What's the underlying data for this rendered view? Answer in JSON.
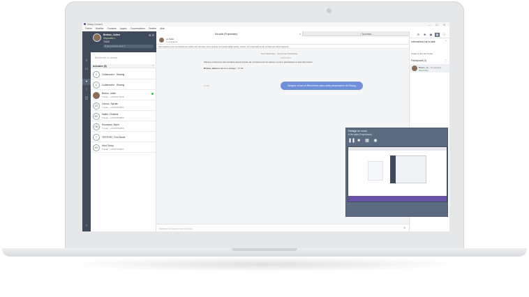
{
  "app": {
    "title": "Dialog Connect",
    "win_controls": [
      "—",
      "☐",
      "✕"
    ]
  },
  "menu": [
    "Fichier",
    "Modifier",
    "Contacts",
    "Appels",
    "Conversations",
    "Fenêtre",
    "Aide"
  ],
  "profile": {
    "name": "Breton, Julien",
    "status": "Disponible ▾",
    "extension": "75155",
    "note": "À quoi pensez-vous ?"
  },
  "contacts": {
    "search_placeholder": "Rechercher un contact",
    "directory_title": "Annuaire (8)",
    "items": [
      {
        "initials": "C",
        "name": "Collaborator - Sharing",
        "sub": "",
        "photo": false,
        "online": false
      },
      {
        "initials": "C",
        "name": "Collaborator - Sharing",
        "sub": "",
        "photo": false,
        "online": false
      },
      {
        "initials": "",
        "name": "Breton, Julien",
        "sub": "Travail : +33183774038",
        "photo": true,
        "online": true
      },
      {
        "initials": "CS",
        "name": "Caruso, Sylvain",
        "sub": "Travail : +33183784853",
        "photo": false,
        "online": false
      },
      {
        "initials": "MC",
        "name": "Mallet, Christine",
        "sub": "Travail : +33183784850",
        "photo": false,
        "online": false
      },
      {
        "initials": "RM",
        "name": "Rousseau, Marie",
        "sub": "Travail : +33183784856",
        "photo": false,
        "online": false
      },
      {
        "initials": "T",
        "name": "TESTDRC, First Name",
        "sub": "",
        "photo": false,
        "online": false
      },
      {
        "initials": "HG",
        "name": "Hunt Group",
        "sub": "Travail : +33183784851",
        "photo": false,
        "online": false
      }
    ]
  },
  "chat": {
    "tab_active": "Ma salle (Propriétaire)",
    "tab_other": "○ Nouveau...",
    "room_line1": "Le Salut",
    "room_line2": "1 participant",
    "info_bar": "Informations pour la conférence audio non fournies. Pour activer la fonctionnalité audio, entrez vos informations de conférence dans Options.",
    "links": "Tout l'historique  ·  Supprimer l'historique",
    "date": "12/01/2017",
    "system_msg": "Glissez et déposez des contacts depuis la liste de contacts pour les ajouter comme participants à cette discussion.",
    "share_msg_name": "Breton, Julien",
    "share_msg_rest": " a lancé le partage : 17:05",
    "bubble": "Bonjour à tous et Bienvenue dans cette présentation de Dialog",
    "time": "17:06",
    "composer_placeholder": "Saisissez un texte ici pour envoyer..."
  },
  "right_panel": {
    "info_title": "Informations sur la salle",
    "link_label": "Copier le lien de l'invité",
    "participants_title": "Participants (1)",
    "participant_name": "Breton, Ju...",
    "participant_role": "Propriétaire",
    "participant_status": "Disponible"
  },
  "share": {
    "title": "Partage en cours",
    "subtitle": "à Ma salle (Propriétaire)"
  },
  "icons": {
    "rail": [
      "star-icon",
      "chat-icon",
      "contacts-icon",
      "dialpad-icon",
      "voicemail-icon"
    ],
    "toolbar": [
      "phone-icon",
      "video-icon",
      "screen-share-icon",
      "present-icon",
      "info-icon"
    ]
  },
  "colors": {
    "rail": "#3f4a5a",
    "bubble": "#6f8fd8",
    "online": "#3fbf4e",
    "share_panel": "#5b6b80"
  }
}
